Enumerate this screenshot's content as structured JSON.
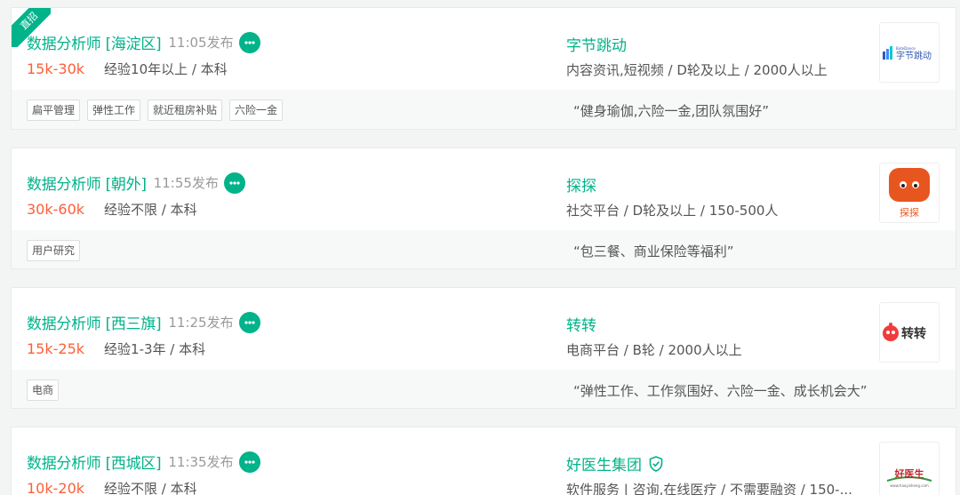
{
  "jobs": [
    {
      "title": "数据分析师 [海淀区]",
      "published": "11:05发布",
      "salary": "15k-30k",
      "requirements": "经验10年以上 / 本科",
      "company": "字节跳动",
      "industry": "内容资讯,短视频 / D轮及以上 / 2000人以上",
      "tags": [
        "扁平管理",
        "弹性工作",
        "就近租房补贴",
        "六险一金"
      ],
      "benefits": "“健身瑜伽,六险一金,团队氛围好”",
      "badge": "直招",
      "logo_text": "字节跳动",
      "logo_subtext": "ByteDance"
    },
    {
      "title": "数据分析师 [朝外]",
      "published": "11:55发布",
      "salary": "30k-60k",
      "requirements": "经验不限 / 本科",
      "company": "探探",
      "industry": "社交平台 / D轮及以上 / 150-500人",
      "tags": [
        "用户研究"
      ],
      "benefits": "“包三餐、商业保险等福利”",
      "logo_text": "探探"
    },
    {
      "title": "数据分析师 [西三旗]",
      "published": "11:25发布",
      "salary": "15k-25k",
      "requirements": "经验1-3年 / 本科",
      "company": "转转",
      "industry": "电商平台 / B轮 / 2000人以上",
      "tags": [
        "电商"
      ],
      "benefits": "“弹性工作、工作氛围好、六险一金、成长机会大”",
      "logo_text": "转转"
    },
    {
      "title": "数据分析师 [西城区]",
      "published": "11:35发布",
      "salary": "10k-20k",
      "requirements": "经验不限 / 本科",
      "company": "好医生集团",
      "industry": "软件服务 | 咨询,在线医疗 / 不需要融资 / 150-...",
      "tags": [],
      "benefits": "",
      "logo_text": "好医生",
      "logo_subtext": "www.haoyisheng.com"
    }
  ],
  "colors": {
    "brand_green": "#00b38a",
    "salary_orange": "#fd5f39",
    "text_gray": "#555555",
    "muted_gray": "#9a9a9a"
  },
  "icons": {
    "chat": "chat-bubble-icon",
    "verified": "shield-check-icon"
  }
}
